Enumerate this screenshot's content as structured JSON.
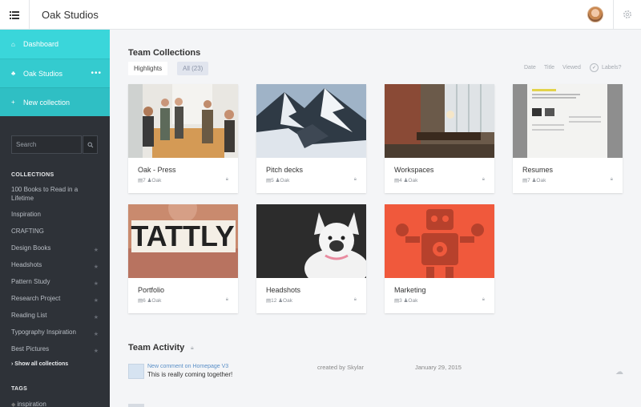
{
  "app": {
    "title": "Oak Studios"
  },
  "sidebar": {
    "nav": [
      {
        "label": "Dashboard",
        "icon": "home-icon"
      },
      {
        "label": "Oak Studios",
        "icon": "team-icon",
        "more": "•••"
      },
      {
        "label": "New collection",
        "icon": "plus-icon"
      }
    ],
    "search_placeholder": "Search",
    "collections_heading": "COLLECTIONS",
    "collections": [
      {
        "label": "100 Books to Read in a Lifetime",
        "starred": false
      },
      {
        "label": "Inspiration",
        "starred": false
      },
      {
        "label": "CRAFTING",
        "starred": false
      },
      {
        "label": "Design Books",
        "starred": true
      },
      {
        "label": "Headshots",
        "starred": true
      },
      {
        "label": "Pattern Study",
        "starred": true
      },
      {
        "label": "Research Project",
        "starred": true
      },
      {
        "label": "Reading List",
        "starred": true
      },
      {
        "label": "Typography Inspiration",
        "starred": true
      },
      {
        "label": "Best Pictures",
        "starred": true
      }
    ],
    "show_all": "Show all collections",
    "tags_heading": "TAGS",
    "tags": [
      "inspiration"
    ]
  },
  "main": {
    "title": "Team Collections",
    "tabs": {
      "highlights": "Highlights",
      "all": "All (23)"
    },
    "sort": {
      "date": "Date",
      "title": "Title",
      "viewed": "Viewed",
      "labels": "Labels?"
    },
    "cards": [
      {
        "name": "Oak - Press",
        "count": "7",
        "owner": "Oak"
      },
      {
        "name": "Pitch decks",
        "count": "5",
        "owner": "Oak"
      },
      {
        "name": "Workspaces",
        "count": "4",
        "owner": "Oak"
      },
      {
        "name": "Resumes",
        "count": "7",
        "owner": "Oak"
      },
      {
        "name": "Portfolio",
        "count": "6",
        "owner": "Oak"
      },
      {
        "name": "Headshots",
        "count": "12",
        "owner": "Oak"
      },
      {
        "name": "Marketing",
        "count": "3",
        "owner": "Oak"
      }
    ],
    "activity": {
      "title": "Team Activity",
      "items": [
        {
          "link": "New comment on Homepage V3",
          "text": "This is really coming together!",
          "by": "created by Skylar",
          "date": "January 29, 2015"
        }
      ]
    }
  },
  "colors": {
    "accent": "#35d0d4",
    "sidebar": "#2e3238",
    "marketing": "#f0593c"
  }
}
